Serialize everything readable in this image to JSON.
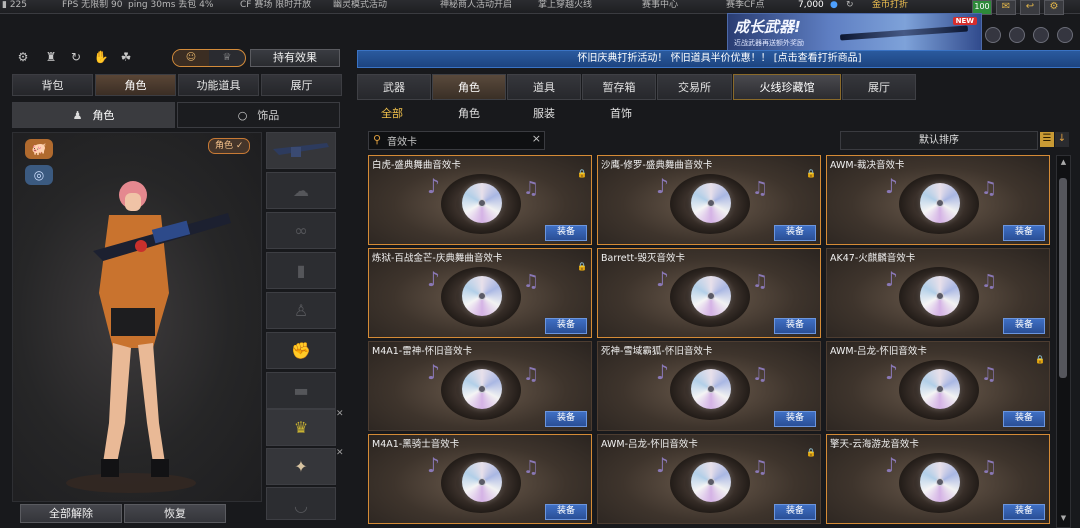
{
  "top_bar": {
    "items": [
      "▮ 225",
      "FPS 无限制  90",
      "ping 30ms 丢包 4%",
      "CF 赛场 限时开放",
      "幽灵模式活动",
      "神秘商人活动开启",
      "掌上穿越火线",
      "赛事中心"
    ],
    "currency_label": "赛季CF点",
    "currency_value": "7,000",
    "coin_label": "金币打折",
    "level": "100"
  },
  "promo": {
    "title": "成长武器!",
    "subtitle": "近战武器再送额外奖励",
    "badge": "NEW"
  },
  "left_panel": {
    "icons": [
      {
        "name": "off-toggle-icon",
        "glyph": "⚙"
      },
      {
        "name": "stats-icon",
        "glyph": "♜"
      },
      {
        "name": "rotate-icon",
        "glyph": "↻"
      },
      {
        "name": "pose-icon",
        "glyph": "✋"
      },
      {
        "name": "pet-icon",
        "glyph": "☘"
      }
    ],
    "hold_effect": "持有效果",
    "tabs": [
      "背包",
      "角色",
      "功能道具",
      "展厅"
    ],
    "active_tab": "角色",
    "subtabs": [
      "角色",
      "饰品"
    ],
    "role_badge": "角色 ✓",
    "unequip_all": "全部解除",
    "restore": "恢复"
  },
  "notice": "怀旧庆典打折活动！ 怀旧道具半价优惠！！ [点击查看打折商品]",
  "main_tabs": [
    "武器",
    "角色",
    "道具",
    "暂存箱",
    "交易所",
    "火线珍藏馆",
    "展厅"
  ],
  "active_main_tab": "火线珍藏馆",
  "sub_tabs": [
    "全部",
    "角色",
    "服装",
    "首饰"
  ],
  "active_sub_tab": "全部",
  "search": {
    "value": "音效卡",
    "clear": "×"
  },
  "sort_label": "默认排序",
  "cards": [
    {
      "title": "白虎-盛典舞曲音效卡",
      "selected": true,
      "locked": true
    },
    {
      "title": "沙鹰-修罗-盛典舞曲音效卡",
      "selected": true,
      "locked": true
    },
    {
      "title": "AWM-裁决音效卡",
      "selected": true,
      "locked": false
    },
    {
      "title": "炼狱-百战金芒-庆典舞曲音效卡",
      "selected": true,
      "locked": true
    },
    {
      "title": "Barrett-毁灭音效卡",
      "selected": true,
      "locked": false
    },
    {
      "title": "AK47-火麒麟音效卡",
      "selected": false,
      "locked": false
    },
    {
      "title": "M4A1-雷神-怀旧音效卡",
      "selected": false,
      "locked": false
    },
    {
      "title": "死神-雪域霸狐-怀旧音效卡",
      "selected": false,
      "locked": false
    },
    {
      "title": "AWM-吕龙-怀旧音效卡",
      "selected": false,
      "locked": true
    },
    {
      "title": "M4A1-黑骑士音效卡",
      "selected": true,
      "locked": false
    },
    {
      "title": "AWM-吕龙-怀旧音效卡",
      "selected": false,
      "locked": true
    },
    {
      "title": "擎天-云海游龙音效卡",
      "selected": true,
      "locked": false
    }
  ],
  "equip_label": "装备"
}
